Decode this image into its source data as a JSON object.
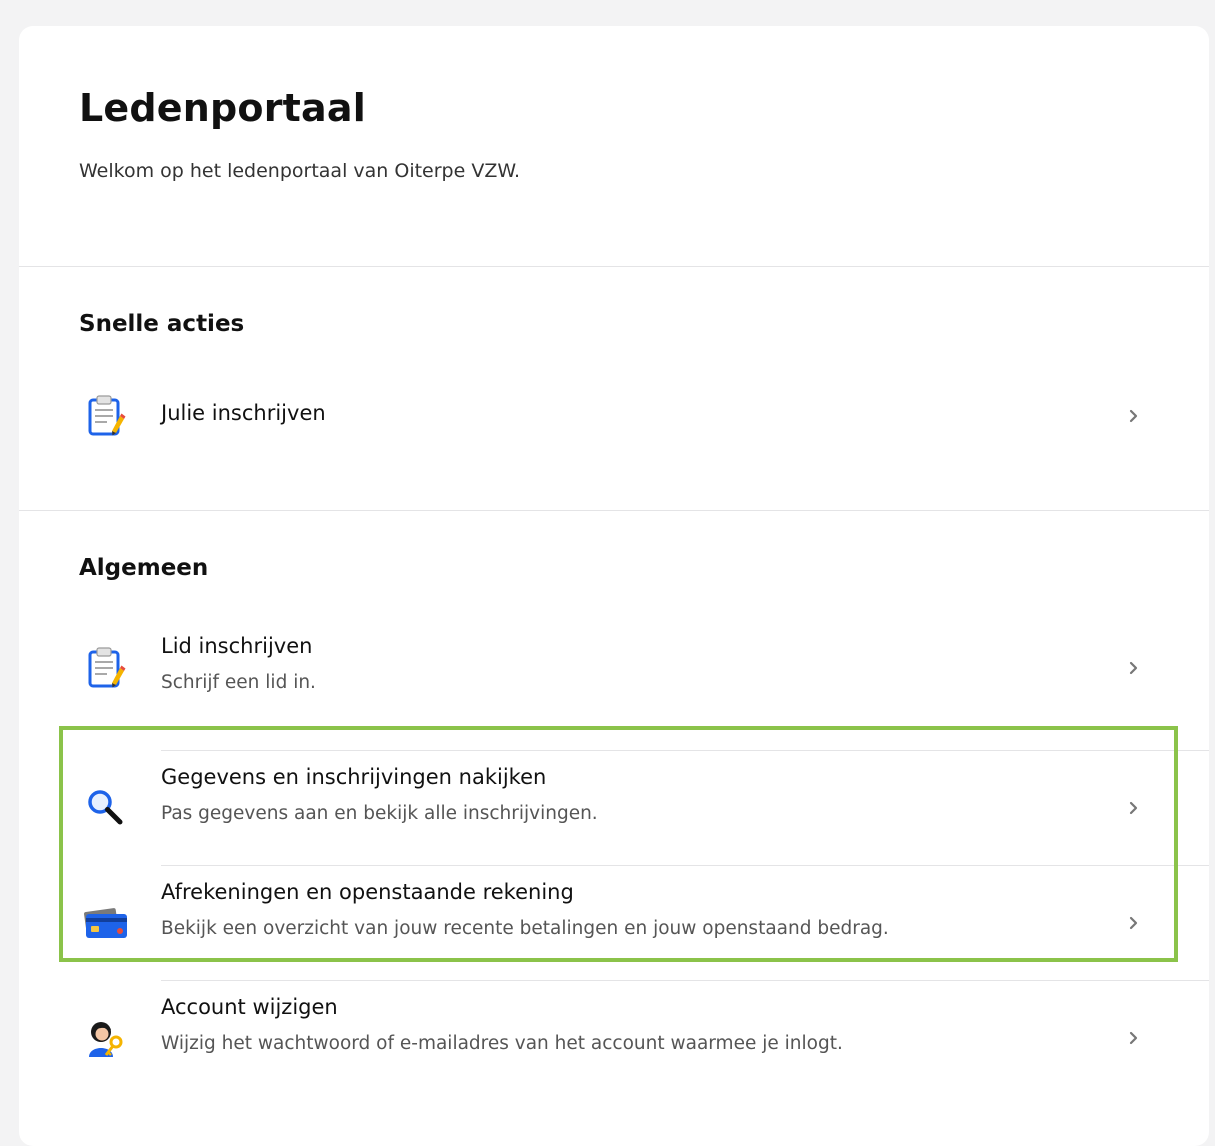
{
  "header": {
    "title": "Ledenportaal",
    "welcome": "Welkom op het ledenportaal van Oiterpe VZW."
  },
  "quick_actions": {
    "title": "Snelle acties",
    "items": [
      {
        "title": "Julie inschrijven",
        "icon": "clipboard-icon"
      }
    ]
  },
  "general": {
    "title": "Algemeen",
    "items": [
      {
        "title": "Lid inschrijven",
        "description": "Schrijf een lid in.",
        "icon": "clipboard-icon"
      },
      {
        "title": "Gegevens en inschrijvingen nakijken",
        "description": "Pas gegevens aan en bekijk alle inschrijvingen.",
        "icon": "magnifier-icon"
      },
      {
        "title": "Afrekeningen en openstaande rekening",
        "description": "Bekijk een overzicht van jouw recente betalingen en jouw openstaand bedrag.",
        "icon": "credit-card-icon"
      },
      {
        "title": "Account wijzigen",
        "description": "Wijzig het wachtwoord of e-mailadres van het account waarmee je inlogt.",
        "icon": "user-key-icon"
      }
    ]
  },
  "colors": {
    "page_background": "#f3f3f4",
    "card_background": "#ffffff",
    "highlight": "#8bc34a",
    "icon_blue": "#1e63e9"
  }
}
